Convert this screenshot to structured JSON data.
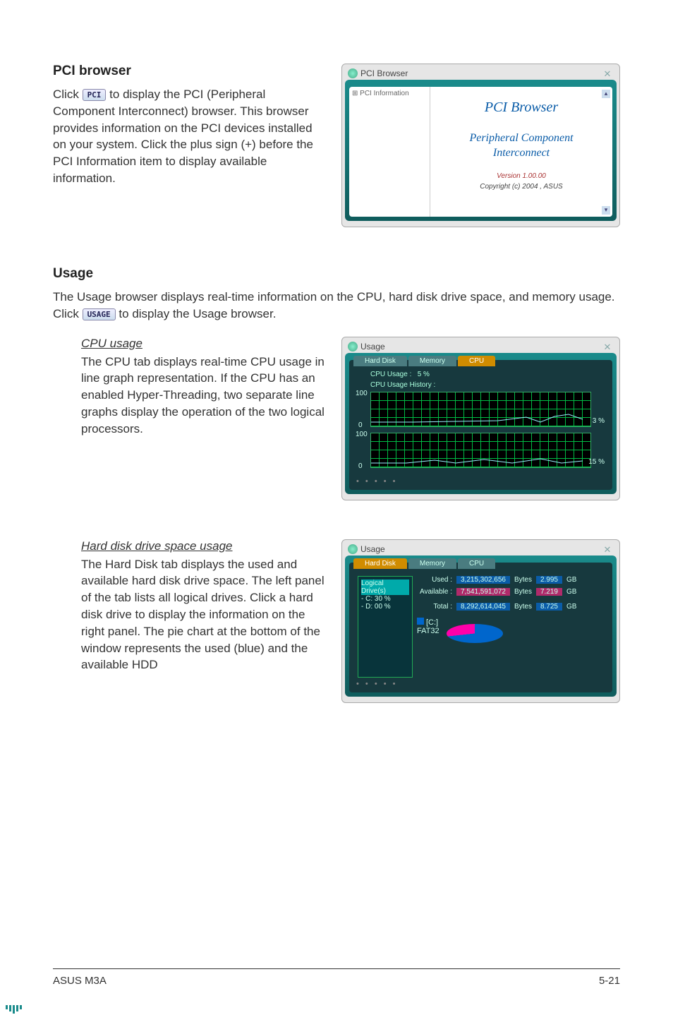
{
  "pci_section": {
    "title": "PCI browser",
    "text_prefix": "Click ",
    "btn": "PCI",
    "text_suffix": " to display the PCI (Peripheral Component Interconnect) browser. This browser provides information on the PCI devices installed on your system. Click the plus sign (+) before the PCI Information item to display available information.",
    "window": {
      "title": "PCI Browser",
      "tree_item": "⊞ PCI Information",
      "heading": "PCI Browser",
      "sub1": "Peripheral Component",
      "sub2": "Interconnect",
      "version": "Version 1.00.00",
      "copyright": "Copyright (c) 2004 , ASUS"
    }
  },
  "usage_section": {
    "title": "Usage",
    "intro_prefix": "The Usage browser displays real-time information on the CPU, hard disk drive space, and memory usage. Click ",
    "btn": "USAGE",
    "intro_suffix": " to display the Usage browser.",
    "cpu": {
      "heading": "CPU usage",
      "body": "The CPU tab displays real-time CPU usage in line graph representation. If the CPU has an enabled Hyper-Threading, two separate line graphs display the operation of the two logical processors.",
      "window": {
        "title": "Usage",
        "tab1": "Hard Disk",
        "tab2": "Memory",
        "tab3": "CPU",
        "label_usage": "CPU Usage :",
        "label_usage_val": "5  %",
        "label_history": "CPU Usage History :",
        "pct1": "3 %",
        "pct2": "15 %"
      }
    },
    "disk": {
      "heading": "Hard disk drive space usage",
      "body": "The Hard Disk tab displays the used and available hard disk drive space. The left panel of the tab lists all logical drives. Click a hard disk drive to display the information on the right panel. The pie chart at the bottom of the window represents the used (blue) and the available HDD",
      "window": {
        "title": "Usage",
        "tab1": "Hard Disk",
        "tab2": "Memory",
        "tab3": "CPU",
        "drives_header": "Logical Drive(s)",
        "drive_c": "- C:  30 %",
        "drive_d": "- D:  00 %",
        "row_used": "Used :",
        "row_avail": "Available :",
        "row_total": "Total :",
        "bytes": "Bytes",
        "used_val": "3,215,302,656",
        "used_gb": "2.995",
        "avail_val": "7,541,591,072",
        "avail_gb": "7.219",
        "total_val": "8,292,614,045",
        "total_gb": "8.725",
        "gb": "GB",
        "legend1": "[C:]",
        "legend2": "FAT32"
      }
    }
  },
  "footer": {
    "left": "ASUS M3A",
    "right": "5-21"
  }
}
